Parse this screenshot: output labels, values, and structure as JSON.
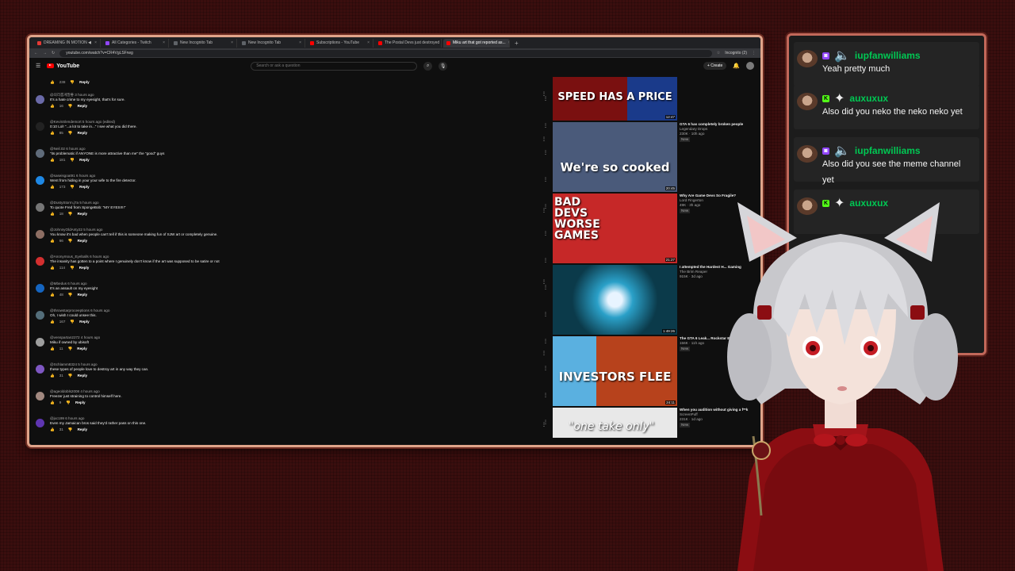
{
  "browser": {
    "tabs": [
      {
        "label": "DREAMING IN MOTION ◀",
        "color": "#e53935"
      },
      {
        "label": "All Categories - Twitch",
        "color": "#9146ff"
      },
      {
        "label": "New Incognito Tab",
        "color": "#5f6368"
      },
      {
        "label": "New Incognito Tab",
        "color": "#5f6368"
      },
      {
        "label": "Subscriptions - YouTube",
        "color": "#ff0000"
      },
      {
        "label": "The Postal Devs just destroyed",
        "color": "#ff0000"
      },
      {
        "label": "Miku art that got reported as...",
        "color": "#ff0000",
        "active": true
      }
    ],
    "url": "youtube.com/watch?v=CR4VgLSFrwg",
    "incognito_label": "Incognito (2)"
  },
  "youtube": {
    "logo": "YouTube",
    "search_placeholder": "Search or ask a question",
    "create_label": "+ Create"
  },
  "top_actions": {
    "likes": "238",
    "reply": "Reply"
  },
  "comments": [
    {
      "user": "@의리롭게말좋 3 hours ago",
      "text": "It's a hate crime to my eyesight, that's for sure.",
      "likes": "16",
      "color": "#6a6aa8"
    },
    {
      "user": "@KevinSlendemort 5 hours ago (edited)",
      "text": "0:10 Lol! \"...a lot to take in...\" I see what you did there.",
      "likes": "85",
      "color": "#222"
    },
    {
      "user": "@Neil.02 6 hours ago",
      "text": "\"its problematic if ANYONE is more attractive than me\" the \"good\" guys",
      "likes": "181",
      "color": "#5f6b7a"
    },
    {
      "user": "@saseisgoat91 6 hours ago",
      "text": "Went from hiding in your your wife to the fire detector.",
      "likes": "173",
      "color": "#1e88e5"
    },
    {
      "user": "@DustyStorm.j7a 5 hours ago",
      "text": "To quote Fred from SpongeBob: \"MY EYES!!!!\"",
      "likes": "18",
      "color": "#757575"
    },
    {
      "user": "@JohnnyOldAnty22 5 hours ago",
      "text": "You know it's bad when people can't tell if this is someone making fun of SJW art or completely genuine.",
      "likes": "66",
      "color": "#8d6e63"
    },
    {
      "user": "@Anonymous_Eyeballs 6 hours ago",
      "text": "The insanity has gotten to a point where I genuinely don't know if the art was supposed to be satire or not",
      "likes": "114",
      "color": "#d32f2f"
    },
    {
      "user": "@Mbedus 6 hours ago",
      "text": "It's an assault on my eyesight",
      "likes": "48",
      "color": "#1565c0"
    },
    {
      "user": "@throwstarproceeptions 6 hours ago",
      "text": "Oh, I wish I could unsee this.",
      "likes": "167",
      "color": "#546e7a"
    },
    {
      "user": "@venspartan2272 4 hours ago",
      "text": "Miku if owned by ubisoft",
      "likes": "11",
      "color": "#9e9e9e"
    },
    {
      "user": "@Schlamm8324 5 hours ago",
      "text": "these types of people love to destroy art in any way they can.",
      "likes": "31",
      "color": "#7e57c2"
    },
    {
      "user": "@ageoldobls2008 4 hours ago",
      "text": "Freezer just straining to control himself here.",
      "likes": "9",
      "color": "#a1887f"
    },
    {
      "user": "@jxc199 6 hours ago",
      "text": "Even my Jamaican bros said they'd rather pass on this one.",
      "likes": "31",
      "color": "#5e35b1"
    }
  ],
  "comment_reply_label": "Reply",
  "videos": [
    {
      "thumb_text": "SPEED HAS A PRICE",
      "duration": "12:47",
      "title": "",
      "channel": "",
      "meta": "",
      "new": "",
      "bg": "#7a1010"
    },
    {
      "thumb_text": "We're so cooked",
      "duration": "20:45",
      "title": "GTA 6 has completely broken people",
      "channel": "Legendary Drops",
      "meta": "230K · 10h ago",
      "new": "New",
      "bg": "#4a5a7a"
    },
    {
      "thumb_text": "BAD DEVS WORSE GAMES",
      "duration": "21:27",
      "title": "Why Are Game Devs So Fragile?",
      "channel": "Lord Fingerton",
      "meta": "49K · 3h ago",
      "new": "New",
      "bg": "#c62828"
    },
    {
      "thumb_text": "",
      "duration": "1:49:26",
      "title": "I attempted the Hardest H... Gaming",
      "channel": "The Brim Reaper",
      "meta": "915K · 3d ago",
      "new": "",
      "bg": "#0b3a4a"
    },
    {
      "thumb_text": "INVESTORS FLEE",
      "duration": "24:11",
      "title": "The GTA 6 Leak... Rockstar Everyt...",
      "channel": "",
      "meta": "156K · 11h ago",
      "new": "New",
      "bg": "#b7421c"
    },
    {
      "thumb_text": "\"one take only\"",
      "duration": "",
      "title": "When you audition without giving a f**k",
      "channel": "ScreenPuff",
      "meta": "231K · 1d ago",
      "new": "New",
      "bg": "#e8e8e8"
    }
  ],
  "chat": {
    "messages": [
      {
        "user": "iupfanwilliams",
        "text": "Yeah pretty much",
        "badge": "twitch",
        "user_color": "#00c853"
      },
      {
        "user": "auxuxux",
        "text": "Also did you neko the neko neko yet",
        "badge": "kick",
        "user_color": "#00c853"
      },
      {
        "user": "iupfanwilliams",
        "text": "Also did you see the meme channel yet",
        "badge": "twitch",
        "user_color": "#00c853"
      },
      {
        "user": "auxuxux",
        "text": "",
        "badge": "kick",
        "user_color": "#00c853"
      }
    ]
  },
  "colors": {
    "frame": "#e0a48a",
    "chat_frame": "#c2685a",
    "background": "#3a0e0e",
    "twitch": "#9146ff",
    "kick": "#53fc18"
  }
}
